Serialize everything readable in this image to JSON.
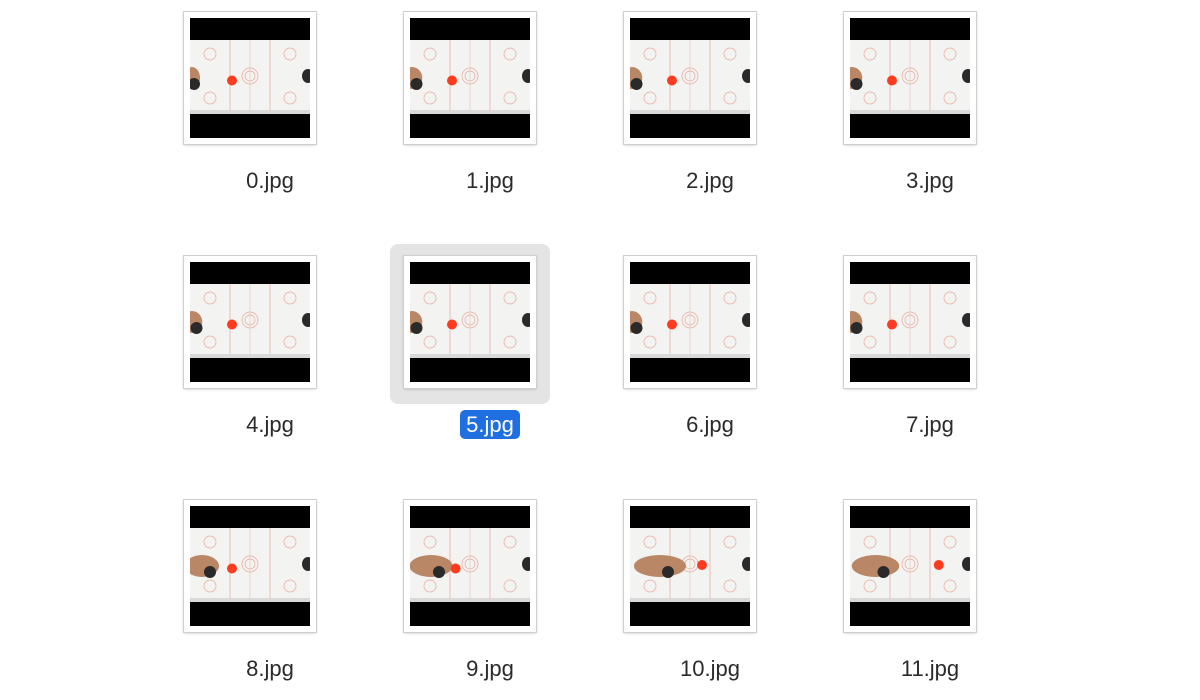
{
  "files": [
    {
      "name": "0.jpg",
      "selected": false,
      "puck": [
        0.35,
        0.55
      ],
      "hand": 0.0
    },
    {
      "name": "1.jpg",
      "selected": false,
      "puck": [
        0.35,
        0.55
      ],
      "hand": 0.05
    },
    {
      "name": "2.jpg",
      "selected": false,
      "puck": [
        0.35,
        0.55
      ],
      "hand": 0.05
    },
    {
      "name": "3.jpg",
      "selected": false,
      "puck": [
        0.35,
        0.55
      ],
      "hand": 0.05
    },
    {
      "name": "4.jpg",
      "selected": false,
      "puck": [
        0.35,
        0.55
      ],
      "hand": 0.05
    },
    {
      "name": "5.jpg",
      "selected": true,
      "puck": [
        0.35,
        0.55
      ],
      "hand": 0.05
    },
    {
      "name": "6.jpg",
      "selected": false,
      "puck": [
        0.35,
        0.55
      ],
      "hand": 0.05
    },
    {
      "name": "7.jpg",
      "selected": false,
      "puck": [
        0.35,
        0.55
      ],
      "hand": 0.05
    },
    {
      "name": "8.jpg",
      "selected": false,
      "puck": [
        0.35,
        0.55
      ],
      "hand": 0.2
    },
    {
      "name": "9.jpg",
      "selected": false,
      "puck": [
        0.38,
        0.55
      ],
      "hand": 0.3
    },
    {
      "name": "10.jpg",
      "selected": false,
      "puck": [
        0.6,
        0.5
      ],
      "hand": 0.4
    },
    {
      "name": "11.jpg",
      "selected": false,
      "puck": [
        0.74,
        0.5
      ],
      "hand": 0.35
    }
  ],
  "colors": {
    "selection_bg": "#1f6fe0",
    "selection_tile": "#e4e4e4",
    "puck": "#ff3b1f",
    "rink": "#f3f3f1",
    "rink_lines": "#e7a79c"
  },
  "icons": {
    "thumbnail": "jpg-thumbnail-icon"
  }
}
